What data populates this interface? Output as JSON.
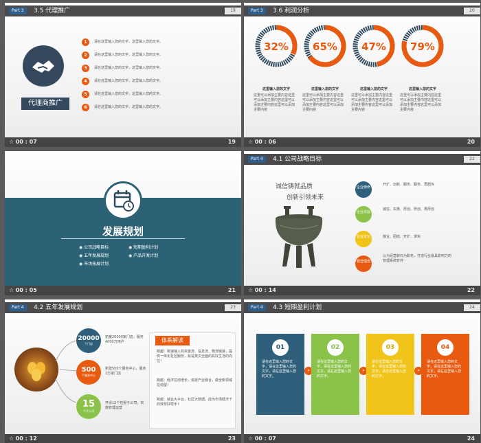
{
  "slides": [
    {
      "part": "Part 3",
      "title": "3.5 代理推广",
      "page": "19",
      "label": "代理商推广",
      "items": [
        {
          "n": "1",
          "text": "请在这里输入您的文字，这里输入您的文字。"
        },
        {
          "n": "2",
          "text": "请在这里输入您的文字，这里输入您的文字。"
        },
        {
          "n": "3",
          "text": "请在这里输入您的文字，这里输入您的文字。"
        },
        {
          "n": "4",
          "text": "请在这里输入您的文字，这里输入您的文字。"
        },
        {
          "n": "5",
          "text": "请在这里输入您的文字，这里输入您的文字。"
        },
        {
          "n": "6",
          "text": "请在这里输入您的文字，这里输入您的文字。"
        }
      ],
      "time": "00 : 07",
      "number": "19"
    },
    {
      "part": "Part 3",
      "title": "3.6 利润分析",
      "page": "20",
      "rings": [
        {
          "value": "32%",
          "pct": 0.32,
          "caption": "这里输入您的文字",
          "body": "这里可以添加主要内容这里可以添加主要内容这里可以添加主要内容这里可以添加主要内容"
        },
        {
          "value": "65%",
          "pct": 0.65,
          "caption": "这里输入您的文字",
          "body": "这里可以添加主要内容这里可以添加主要内容这里可以添加主要内容这里可以添加主要内容"
        },
        {
          "value": "47%",
          "pct": 0.47,
          "caption": "这里输入您的文字",
          "body": "这里可以添加主要内容这里可以添加主要内容这里可以添加主要内容这里可以添加主要内容"
        },
        {
          "value": "79%",
          "pct": 0.79,
          "caption": "这里输入您的文字",
          "body": "这里可以添加主要内容这里可以添加主要内容这里可以添加主要内容这里可以添加主要内容"
        }
      ],
      "time": "00 : 06",
      "number": "20"
    },
    {
      "title": "发展规划",
      "items": [
        "公司战略目标",
        "短期盈利计划",
        "五年发展规划",
        "产品开发计划",
        "市场拓展计划"
      ],
      "time": "00 : 05",
      "number": "21"
    },
    {
      "part": "Part 4",
      "title": "4.1 公司战略目标",
      "page": "22",
      "slogan1": "诚信铸就品质",
      "slogan2": "创新引领未来",
      "rows": [
        {
          "tag": "企业使命",
          "text": "开扩、创新、服务、服务、再服务",
          "color": "#2f5f7a"
        },
        {
          "tag": "企业宗旨",
          "text": "诚信、实惠、厚创、厚创、再厚创",
          "color": "#8bc34a"
        },
        {
          "tag": "企业文化",
          "text": "敬业、团结、开扩、求实",
          "color": "#f0c419"
        },
        {
          "tag": "经营理念",
          "text": "以为经营转石为职务，打造行业最具影响力的管理系统软件",
          "color": "#e85a10"
        }
      ],
      "time": "00 : 14",
      "number": "22"
    },
    {
      "part": "Part 4",
      "title": "4.2 五年发展规划",
      "page": "23",
      "stats": [
        {
          "big": "20000",
          "small": "个门店",
          "text": "拓宽20000家门店，服务4000万用户",
          "color": "#2f5f7a"
        },
        {
          "big": "500",
          "small": "个服务中心",
          "text": "新建500个服务中心，服务2万家门店",
          "color": "#e85a10"
        },
        {
          "big": "15",
          "small": "个子公司",
          "text": "开设15个控股子公司，实施管理运营",
          "color": "#8bc34a"
        }
      ],
      "panel_title": "体系解读",
      "panel_items": [
        "跨越：跨速输入的资金流、信息流、物流链接，提供一体化社区服务，就是英文全面的具好生活的向往！",
        "跨越：经济拉动增长，追逐产业融合，做全新领域拉动型！",
        "跨越：就业大平台，社区大数据，成为市场经济下的效劳好帮手！"
      ],
      "time": "00 : 12",
      "number": "23"
    },
    {
      "part": "Part 4",
      "title": "4.3 短期盈利计划",
      "page": "24",
      "cards": [
        {
          "n": "01",
          "text": "请在这里输入您的文字，请在这里输入您的文字，请在这里输入您的文字。",
          "color": "#2f5f7a"
        },
        {
          "n": "02",
          "text": "请在这里输入您的文字，请在这里输入您的文字，请在这里输入您的文字。",
          "color": "#8bc34a"
        },
        {
          "n": "03",
          "text": "请在这里输入您的文字，请在这里输入您的文字，请在这里输入您的文字。",
          "color": "#f0c419"
        },
        {
          "n": "04",
          "text": "请在这里输入您的文字，请在这里输入您的文字，请在这里输入您的文字。",
          "color": "#e85a10"
        }
      ],
      "time": "00 : 07",
      "number": "24"
    }
  ]
}
